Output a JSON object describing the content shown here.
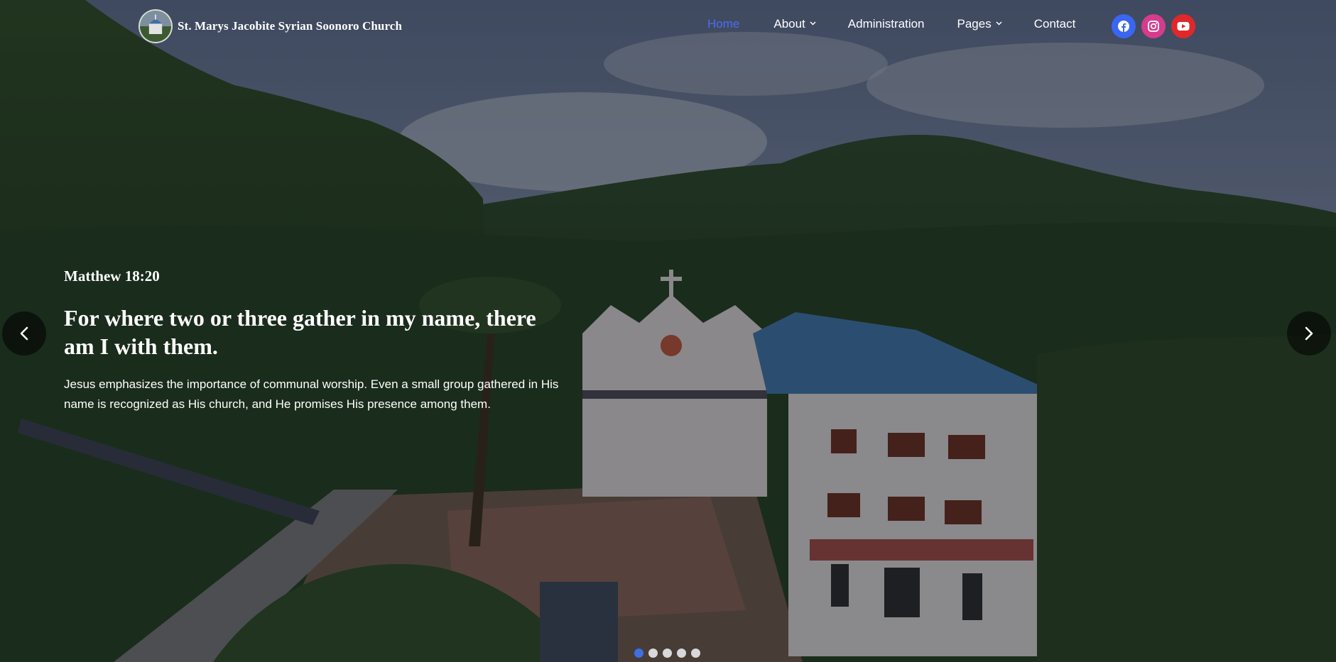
{
  "brand": {
    "name": "St. Marys Jacobite Syrian Soonoro Church",
    "logo_icon": "church-logo"
  },
  "nav": {
    "items": [
      {
        "label": "Home",
        "active": true,
        "has_dropdown": false
      },
      {
        "label": "About",
        "active": false,
        "has_dropdown": true
      },
      {
        "label": "Administration",
        "active": false,
        "has_dropdown": false
      },
      {
        "label": "Pages",
        "active": false,
        "has_dropdown": true
      },
      {
        "label": "Contact",
        "active": false,
        "has_dropdown": false
      }
    ],
    "active_color": "#4d6cf0"
  },
  "socials": [
    {
      "name": "facebook-icon",
      "color": "#3a66f2"
    },
    {
      "name": "instagram-icon",
      "color": "#d63b8c"
    },
    {
      "name": "youtube-icon",
      "color": "#e0282b"
    }
  ],
  "slide": {
    "reference": "Matthew 18:20",
    "verse": "For where two or three gather in my name, there am I with them.",
    "description": "Jesus emphasizes the importance of communal worship. Even a small group gathered in His name is recognized as His church, and He promises His presence among them."
  },
  "carousel": {
    "prev_icon": "chevron-left-icon",
    "next_icon": "chevron-right-icon",
    "slide_count": 5,
    "active_index": 0
  }
}
